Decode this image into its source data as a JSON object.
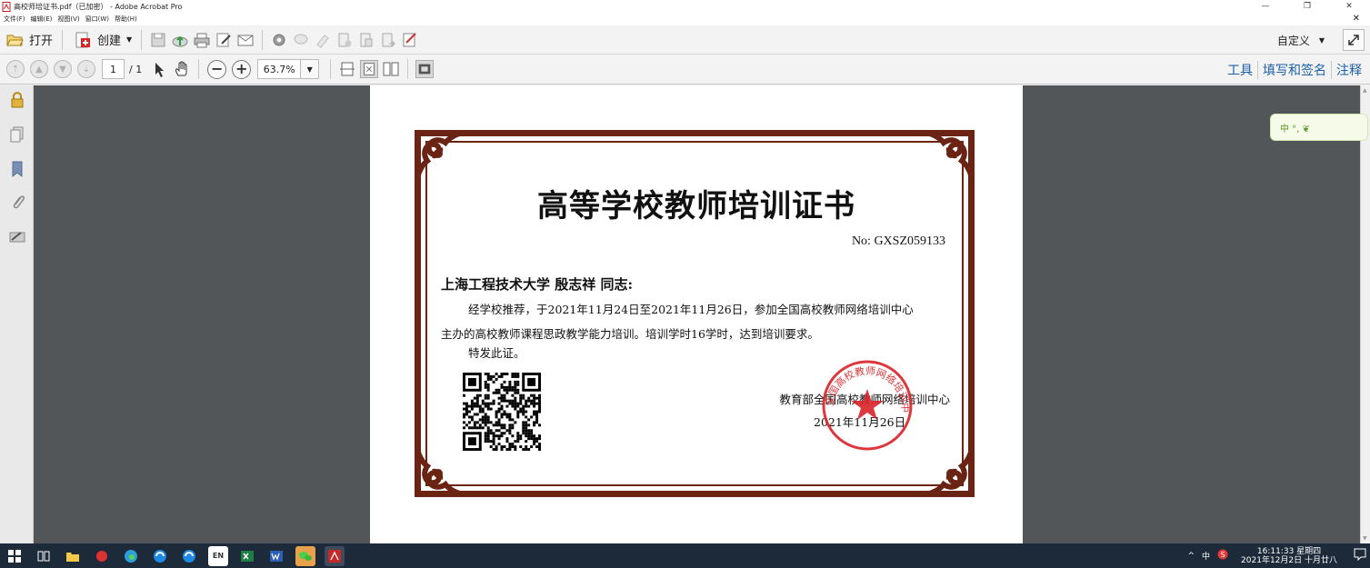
{
  "window": {
    "title": "高校师培证书.pdf（已加密） - Adobe Acrobat Pro"
  },
  "menu": {
    "items": [
      "文件(F)",
      "编辑(E)",
      "视图(V)",
      "窗口(W)",
      "帮助(H)"
    ]
  },
  "toolbar1": {
    "open_label": "打开",
    "create_label": "创建",
    "customize_label": "自定义"
  },
  "toolbar2": {
    "page_current": "1",
    "page_total": "/ 1",
    "zoom": "63.7%",
    "tools_label": "工具",
    "fill_sign_label": "填写和签名",
    "comment_label": "注释"
  },
  "certificate": {
    "title": "高等学校教师培训证书",
    "number": "No:  GXSZ059133",
    "recipient": "上海工程技术大学 殷志祥 同志:",
    "body_line1": "经学校推荐，于2021年11月24日至2021年11月26日，参加全国高校教师网络培训中心",
    "body_line2": "主办的高校教师课程思政教学能力培训。培训学时16学时，达到培训要求。",
    "body_line3": "特发此证。",
    "issuer": "教育部全国高校教师网络培训中心",
    "date": "2021年11月26日",
    "seal_text": "全国高校教师网络培训中心",
    "border_color": "#6b2414",
    "seal_color": "#d9232a"
  },
  "ime": {
    "label": "中 °, ❦"
  },
  "taskbar": {
    "lang_badge": "EN",
    "tray_caret": "^",
    "tray_ime": "中",
    "time": "16:11:33 星期四",
    "date": "2021年12月2日 十月廿八"
  }
}
